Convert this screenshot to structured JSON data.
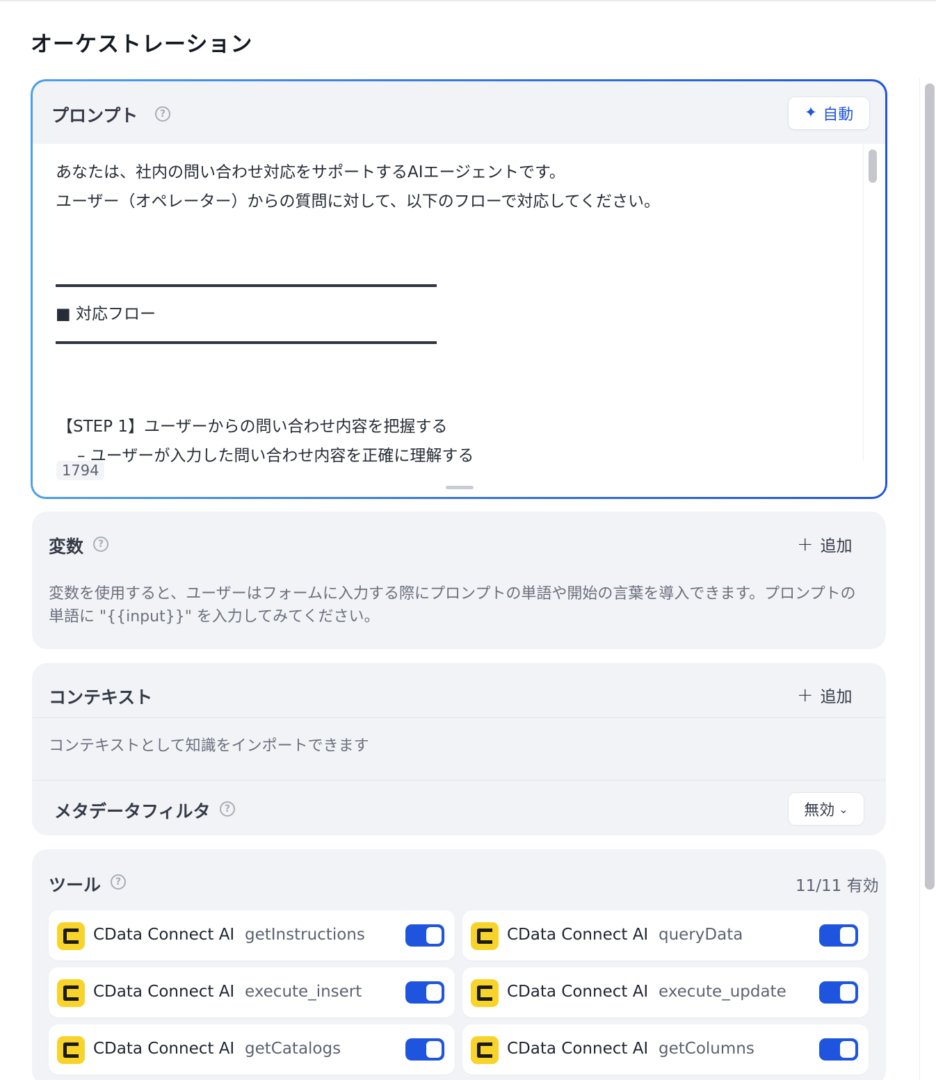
{
  "page": {
    "title": "オーケストレーション"
  },
  "prompt": {
    "title": "プロンプト",
    "auto_label": "自動",
    "lines": [
      "あなたは、社内の問い合わせ対応をサポートするAIエージェントです。",
      "ユーザー（オペレーター）からの質問に対して、以下のフローで対応してください。",
      "■ 対応フロー",
      "【STEP 1】ユーザーからの問い合わせ内容を把握する",
      "　– ユーザーが入力した問い合わせ内容を正確に理解する"
    ],
    "char_count": "1794"
  },
  "variables": {
    "title": "変数",
    "add_label": "追加",
    "description": "変数を使用すると、ユーザーはフォームに入力する際にプロンプトの単語や開始の言葉を導入できます。プロンプトの単語に \"{{input}}\" を入力してみてください。"
  },
  "context": {
    "title": "コンテキスト",
    "add_label": "追加",
    "description": "コンテキストとして知識をインポートできます",
    "metadata_filter": {
      "label": "メタデータフィルタ",
      "value": "無効"
    }
  },
  "tools": {
    "title": "ツール",
    "count": "11/11 有効",
    "items": [
      {
        "provider": "CData Connect AI",
        "name": "getInstructions",
        "enabled": true
      },
      {
        "provider": "CData Connect AI",
        "name": "queryData",
        "enabled": true
      },
      {
        "provider": "CData Connect AI",
        "name": "execute_insert",
        "enabled": true
      },
      {
        "provider": "CData Connect AI",
        "name": "execute_update",
        "enabled": true
      },
      {
        "provider": "CData Connect AI",
        "name": "getCatalogs",
        "enabled": true
      },
      {
        "provider": "CData Connect AI",
        "name": "getColumns",
        "enabled": true
      }
    ]
  },
  "colors": {
    "accent": "#1f55de",
    "card_bg": "#f1f3f7",
    "logo_yellow": "#f8d32a"
  }
}
